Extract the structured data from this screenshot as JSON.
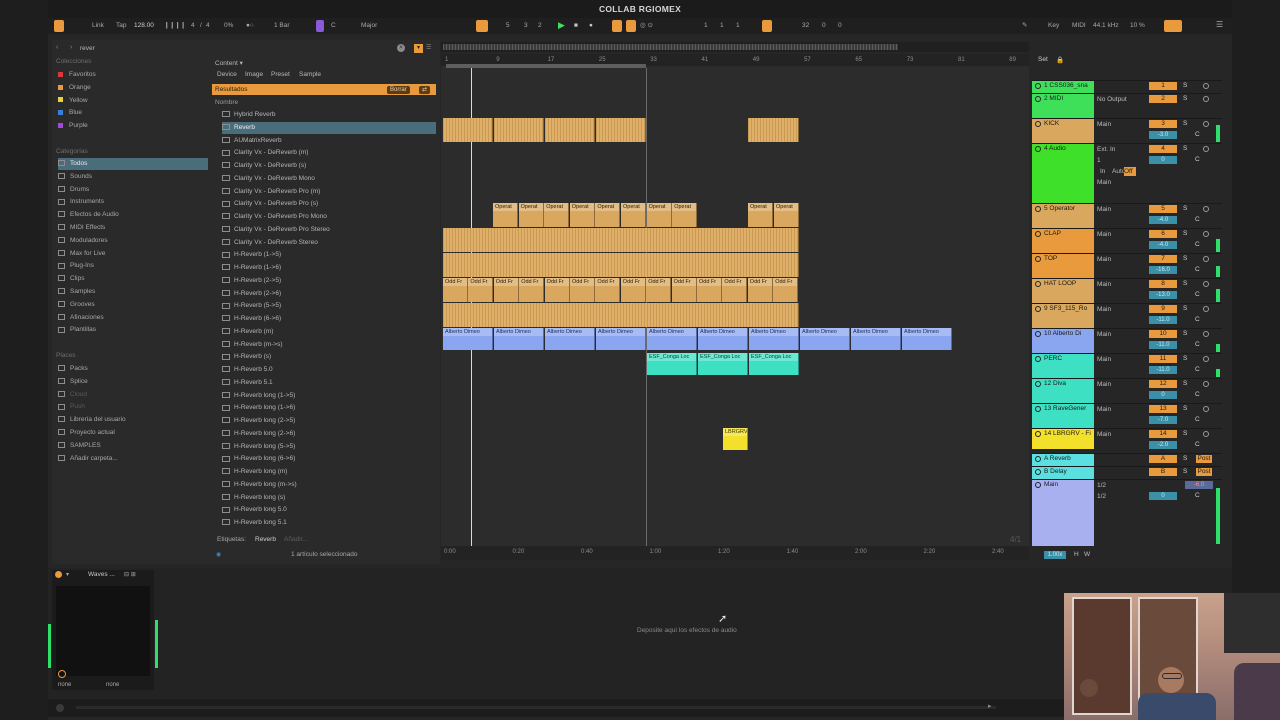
{
  "window": {
    "title": "COLLAB RGIOMEX"
  },
  "control_bar": {
    "link": "Link",
    "tap": "Tap",
    "tempo": "128.00",
    "time_sig_num": "4",
    "time_sig_den": "4",
    "cpu_zero": "0%",
    "quantize": "1 Bar",
    "key": "C",
    "scale": "Major",
    "position": [
      "5",
      "3",
      "2"
    ],
    "loop_start": [
      "1",
      "1",
      "1"
    ],
    "loop_len": [
      "32",
      "0",
      "0"
    ],
    "key_btn": "Key",
    "midi_btn": "MIDI",
    "sample_rate": "44.1 kHz",
    "cpu": "10 %"
  },
  "browser": {
    "search_value": "rever",
    "collections_header": "Colecciones",
    "collections": [
      {
        "label": "Favoritos",
        "color": "#d83a3a"
      },
      {
        "label": "Orange",
        "color": "#e89a3c"
      },
      {
        "label": "Yellow",
        "color": "#e8d23a"
      },
      {
        "label": "Blue",
        "color": "#3a7ed8"
      },
      {
        "label": "Purple",
        "color": "#a04ad8"
      }
    ],
    "categories_header": "Categorías",
    "categories": [
      "Todos",
      "Sounds",
      "Drums",
      "Instruments",
      "Efectos de Audio",
      "MIDI Effects",
      "Moduladores",
      "Max for Live",
      "Plug-Ins",
      "Clips",
      "Samples",
      "Grooves",
      "Afinaciones",
      "Plantillas"
    ],
    "places_header": "Places",
    "places": [
      "Packs",
      "Splice",
      "Cloud",
      "Push",
      "Librería del usuario",
      "Proyecto actual",
      "SAMPLES",
      "Añadir carpeta..."
    ],
    "filter_content": "Content ▾",
    "filter_tabs": [
      "Device",
      "Image",
      "Preset",
      "Sample"
    ],
    "results_label": "Resultados",
    "clear_button": "Borrar",
    "name_header": "Nombre",
    "results": [
      "Hybrid Reverb",
      "Reverb",
      "AUMatrixReverb",
      "Clarity Vx - DeReverb (m)",
      "Clarity Vx - DeReverb (s)",
      "Clarity Vx - DeReverb Mono",
      "Clarity Vx - DeReverb Pro (m)",
      "Clarity Vx - DeReverb Pro (s)",
      "Clarity Vx - DeReverb Pro Mono",
      "Clarity Vx - DeReverb Pro Stereo",
      "Clarity Vx - DeReverb Stereo",
      "H-Reverb (1->5)",
      "H-Reverb (1->6)",
      "H-Reverb (2->5)",
      "H-Reverb (2->6)",
      "H-Reverb (5->5)",
      "H-Reverb (6->6)",
      "H-Reverb (m)",
      "H-Reverb (m->s)",
      "H-Reverb (s)",
      "H-Reverb 5.0",
      "H-Reverb 5.1",
      "H-Reverb long (1->5)",
      "H-Reverb long (1->6)",
      "H-Reverb long (2->5)",
      "H-Reverb long (2->6)",
      "H-Reverb long (5->5)",
      "H-Reverb long (6->6)",
      "H-Reverb long (m)",
      "H-Reverb long (m->s)",
      "H-Reverb long (s)",
      "H-Reverb long 5.0",
      "H-Reverb long 5.1"
    ],
    "selected_result": 1,
    "tags_label": "Etiquetas:",
    "tag_value": "Reverb",
    "tag_add": "Añadir...",
    "status": "1 artículo seleccionado"
  },
  "ruler": [
    "1",
    "9",
    "17",
    "25",
    "33",
    "41",
    "49",
    "57",
    "65",
    "73",
    "81",
    "89"
  ],
  "timeline": [
    "0:00",
    "0:20",
    "0:40",
    "1:00",
    "1:20",
    "1:40",
    "2:00",
    "2:20",
    "2:40"
  ],
  "arrangement": {
    "operat_label": "Operat",
    "oddfr_label": "Odd Fr",
    "alberto_label": "Alberto Dimeo",
    "conga_label": "ESF_Conga Loc",
    "lbrgrv_label": "LBRGRV",
    "page_indicator": "4/1"
  },
  "mixer": {
    "set_label": "Set",
    "tracks": [
      {
        "name": "1 CSS036_sna",
        "color": "#3ee05a",
        "io": "",
        "num": "1",
        "vol": "",
        "meter": 0
      },
      {
        "name": "2 MIDI",
        "color": "#3ee05a",
        "io": "No Output",
        "num": "2",
        "vol": "",
        "meter": 0
      },
      {
        "name": "KICK",
        "color": "#d9a85e",
        "io": "Main",
        "num": "3",
        "vol": "-3.0",
        "meter": 0.8
      },
      {
        "name": "4 Audio",
        "color": "#3ee02a",
        "io": "Ext. In",
        "io2": "1",
        "num": "4",
        "vol": "0",
        "monitor": [
          "In",
          "Auto",
          "Off"
        ],
        "main": "Main",
        "meter": 0
      },
      {
        "name": "5 Operator",
        "color": "#d9a85e",
        "io": "Main",
        "num": "5",
        "vol": "-4.0",
        "meter": 0
      },
      {
        "name": "CLAP",
        "color": "#e89a3c",
        "io": "Main",
        "num": "6",
        "vol": "-4.0",
        "meter": 0.6
      },
      {
        "name": "TOP",
        "color": "#e89a3c",
        "io": "Main",
        "num": "7",
        "vol": "-16.0",
        "meter": 0.5
      },
      {
        "name": "HAT LOOP",
        "color": "#d9a85e",
        "io": "Main",
        "num": "8",
        "vol": "-13.0",
        "meter": 0.6
      },
      {
        "name": "9 SF3_115_Ro",
        "color": "#d9a85e",
        "io": "Main",
        "num": "9",
        "vol": "-11.0",
        "meter": 0
      },
      {
        "name": "10 Alberto Di",
        "color": "#8aa6f0",
        "io": "Main",
        "num": "10",
        "vol": "-11.0",
        "meter": 0.4
      },
      {
        "name": "PERC",
        "color": "#3ee0c4",
        "io": "Main",
        "num": "11",
        "vol": "-11.0",
        "meter": 0.4
      },
      {
        "name": "12 Diva",
        "color": "#3ee0c4",
        "io": "Main",
        "num": "12",
        "vol": "0",
        "meter": 0
      },
      {
        "name": "13 RaveGener",
        "color": "#3ee0c4",
        "io": "Main",
        "num": "13",
        "vol": "-7.0",
        "meter": 0
      },
      {
        "name": "14 LBRGRV - Fi",
        "color": "#f2e02a",
        "io": "Main",
        "num": "14",
        "vol": "-2.0",
        "meter": 0
      },
      {
        "name": "A Reverb",
        "color": "#5ae0e0",
        "io": "",
        "num": "A",
        "vol": "",
        "post": "Post",
        "meter": 0
      },
      {
        "name": "B Delay",
        "color": "#5ae0e0",
        "io": "",
        "num": "B",
        "vol": "",
        "post": "Post",
        "meter": 0
      },
      {
        "name": "Main",
        "color": "#a8b0f0",
        "io": "1/2",
        "io2": "1/2",
        "num": "",
        "vol": "0",
        "vol_b": "-6.0",
        "meter": 0.9
      }
    ],
    "zoom": "1.00x",
    "h_label": "H",
    "w_label": "W"
  },
  "device": {
    "plugin_title": "Waves ...",
    "drop_hint": "Deposite aquí los efectos de audio",
    "in_label": "none",
    "out_label": "none"
  }
}
